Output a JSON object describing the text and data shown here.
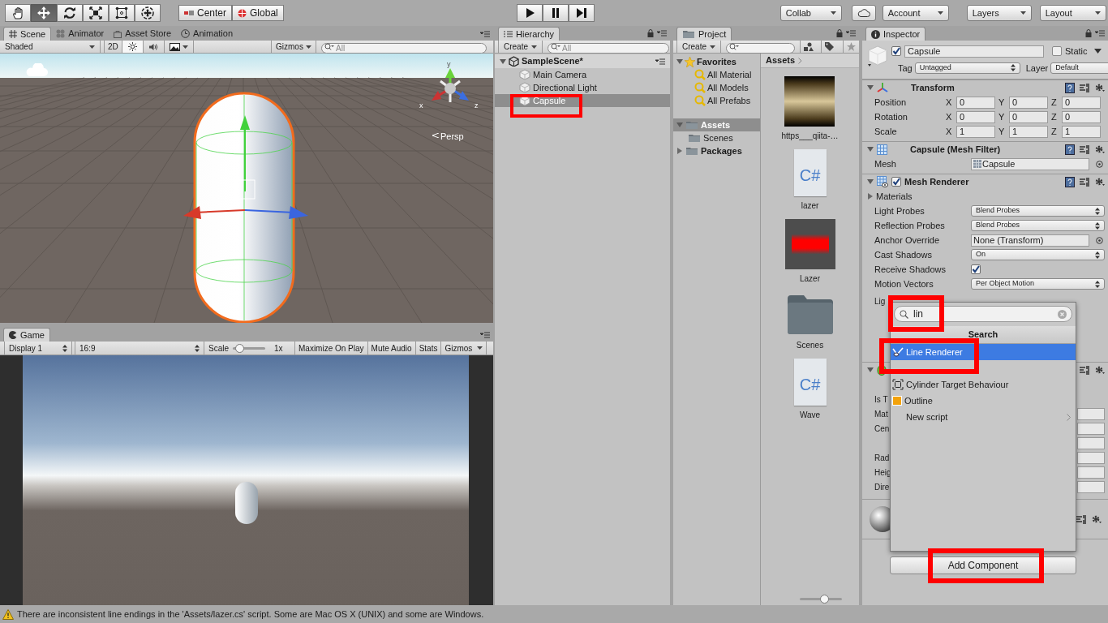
{
  "toolbar": {
    "tools": [
      {
        "kind": "hand",
        "selected": false
      },
      {
        "kind": "move",
        "selected": true
      },
      {
        "kind": "rotate",
        "selected": false
      },
      {
        "kind": "scale",
        "selected": false
      },
      {
        "kind": "rect",
        "selected": false
      },
      {
        "kind": "transform",
        "selected": false
      }
    ],
    "pivot": [
      {
        "kind": "pivot",
        "label": "Center"
      },
      {
        "kind": "space",
        "label": "Global"
      }
    ],
    "playback": [
      {
        "kind": "play"
      },
      {
        "kind": "pause"
      },
      {
        "kind": "step"
      }
    ],
    "collab": "Collab",
    "account": "Account",
    "layers": "Layers",
    "layout": "Layout"
  },
  "scene_panel": {
    "tabs": [
      {
        "kind": "scene",
        "label": "Scene",
        "selected": true
      },
      {
        "kind": "animator",
        "label": "Animator",
        "selected": false
      },
      {
        "kind": "store",
        "label": "Asset Store",
        "selected": false
      },
      {
        "kind": "animation",
        "label": "Animation",
        "selected": false
      }
    ],
    "shading": "Shaded",
    "mode": "2D",
    "lighting_on": true,
    "audio_on": false,
    "gizmos": "Gizmos",
    "search": {
      "placeholder": "All"
    },
    "axes": {
      "y": "y",
      "x": "x",
      "z": "z"
    },
    "view_label": "Persp"
  },
  "game_panel": {
    "tabs": [
      {
        "label": "Game",
        "selected": true
      }
    ],
    "display": "Display 1",
    "aspect": "16:9",
    "scale_label": "Scale",
    "scale": {
      "level": 0.12
    },
    "scale_value": "1x",
    "toggles": [
      "Maximize On Play",
      "Mute Audio",
      "Stats"
    ],
    "gizmos": "Gizmos"
  },
  "hierarchy": {
    "tab": "Hierarchy",
    "create": "Create",
    "search": {
      "placeholder": "All"
    },
    "scene": "SampleScene*",
    "items": [
      {
        "label": "Main Camera",
        "selected": false
      },
      {
        "label": "Directional Light",
        "selected": false
      },
      {
        "label": "Capsule",
        "selected": true
      }
    ]
  },
  "project": {
    "tab": "Project",
    "create": "Create",
    "favorites": {
      "label": "Favorites",
      "expanded": true,
      "items": [
        "All Material",
        "All Models",
        "All Prefabs"
      ]
    },
    "folders": [
      {
        "label": "Assets",
        "expanded": true,
        "selected": true,
        "children": [
          {
            "label": "Scenes",
            "selected": false
          }
        ]
      },
      {
        "label": "Packages",
        "expanded": false,
        "selected": false
      }
    ],
    "breadcrumb": "Assets",
    "assets": [
      {
        "kind": "texture",
        "label": "https___qiita-…"
      },
      {
        "kind": "script",
        "badge": "C#",
        "label": "lazer"
      },
      {
        "kind": "material",
        "label": "Lazer"
      },
      {
        "kind": "folder",
        "label": "Scenes"
      },
      {
        "kind": "script",
        "badge": "C#",
        "label": "Wave"
      }
    ],
    "icon_size": {
      "level": 0.6
    }
  },
  "inspector": {
    "tab": "Inspector",
    "active": true,
    "name": "Capsule",
    "static_label": "Static",
    "static": false,
    "tag_label": "Tag",
    "tag": "Untagged",
    "layer_label": "Layer",
    "layer": "Default",
    "components": [
      {
        "kind": "transform",
        "title": "Transform",
        "expanded": true,
        "rows": [
          {
            "kind": "vector",
            "label": "Position",
            "values": [
              {
                "axis": "X",
                "value": "0"
              },
              {
                "axis": "Y",
                "value": "0"
              },
              {
                "axis": "Z",
                "value": "0"
              }
            ]
          },
          {
            "kind": "vector",
            "label": "Rotation",
            "values": [
              {
                "axis": "X",
                "value": "0"
              },
              {
                "axis": "Y",
                "value": "0"
              },
              {
                "axis": "Z",
                "value": "0"
              }
            ]
          },
          {
            "kind": "vector",
            "label": "Scale",
            "values": [
              {
                "axis": "X",
                "value": "1"
              },
              {
                "axis": "Y",
                "value": "1"
              },
              {
                "axis": "Z",
                "value": "1"
              }
            ]
          }
        ]
      },
      {
        "kind": "mesh_filter",
        "title": "Capsule (Mesh Filter)",
        "expanded": true,
        "rows": [
          {
            "kind": "object",
            "label": "Mesh",
            "value": "Capsule",
            "icon": true
          }
        ]
      },
      {
        "kind": "mesh_renderer",
        "title": "Mesh Renderer",
        "enabled": true,
        "expanded": true,
        "rows": [
          {
            "kind": "foldout",
            "label": "Materials",
            "expanded": false
          },
          {
            "kind": "dropdown",
            "label": "Light Probes",
            "value": "Blend Probes"
          },
          {
            "kind": "dropdown",
            "label": "Reflection Probes",
            "value": "Blend Probes"
          },
          {
            "kind": "object",
            "label": "Anchor Override",
            "value": "None (Transform)",
            "icon": false
          },
          {
            "kind": "dropdown",
            "label": "Cast Shadows",
            "value": "On"
          },
          {
            "kind": "checkbox",
            "label": "Receive Shadows",
            "checked": true
          },
          {
            "kind": "dropdown",
            "label": "Motion Vectors",
            "value": "Per Object Motion"
          }
        ]
      }
    ],
    "covered_labels": [
      "Lig",
      "Is T",
      "Mat",
      "Cen",
      "Rad",
      "Heig",
      "Dire"
    ],
    "add_button": "Add Component"
  },
  "add_component_popup": {
    "query": "lin",
    "heading": "Search",
    "items": [
      {
        "kind": "line_renderer",
        "label": "Line Renderer",
        "selected": true
      },
      {
        "kind": "target",
        "label": "Cylinder Target Behaviour",
        "selected": false
      },
      {
        "kind": "outline",
        "label": "Outline",
        "selected": false
      },
      {
        "kind": "new_script",
        "label": "New script",
        "selected": false
      }
    ]
  },
  "status_bar": {
    "message": "There are inconsistent line endings in the 'Assets/lazer.cs' script. Some are Mac OS X (UNIX) and some are Windows."
  }
}
